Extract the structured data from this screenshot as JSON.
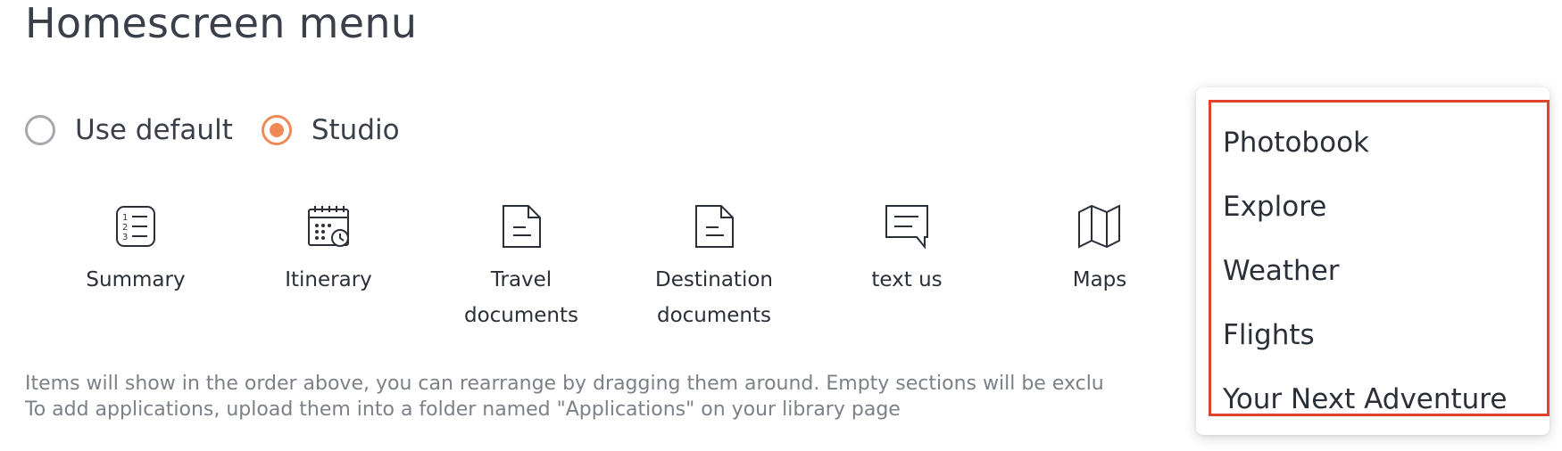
{
  "page": {
    "title": "Homescreen menu"
  },
  "radio": {
    "options": [
      {
        "label": "Use default",
        "checked": false
      },
      {
        "label": "Studio",
        "checked": true
      }
    ],
    "accent_color": "#ee8a55"
  },
  "tiles": [
    {
      "label": "Summary",
      "icon": "numbered-list-icon"
    },
    {
      "label": "Itinerary",
      "icon": "calendar-clock-icon"
    },
    {
      "label": "Travel documents",
      "icon": "document-icon"
    },
    {
      "label": "Destination documents",
      "icon": "document-icon"
    },
    {
      "label": "text us",
      "icon": "chat-bubble-icon"
    },
    {
      "label": "Maps",
      "icon": "folded-map-icon"
    }
  ],
  "hint": {
    "line1": "Items will show in the order above, you can rearrange by dragging them around. Empty sections will be exclu",
    "line2": "To add applications, upload them into a folder named \"Applications\" on your library page"
  },
  "dropdown": {
    "items": [
      "Photobook",
      "Explore",
      "Weather",
      "Flights",
      "Your Next Adventure"
    ],
    "highlight_color": "#e0442e"
  }
}
